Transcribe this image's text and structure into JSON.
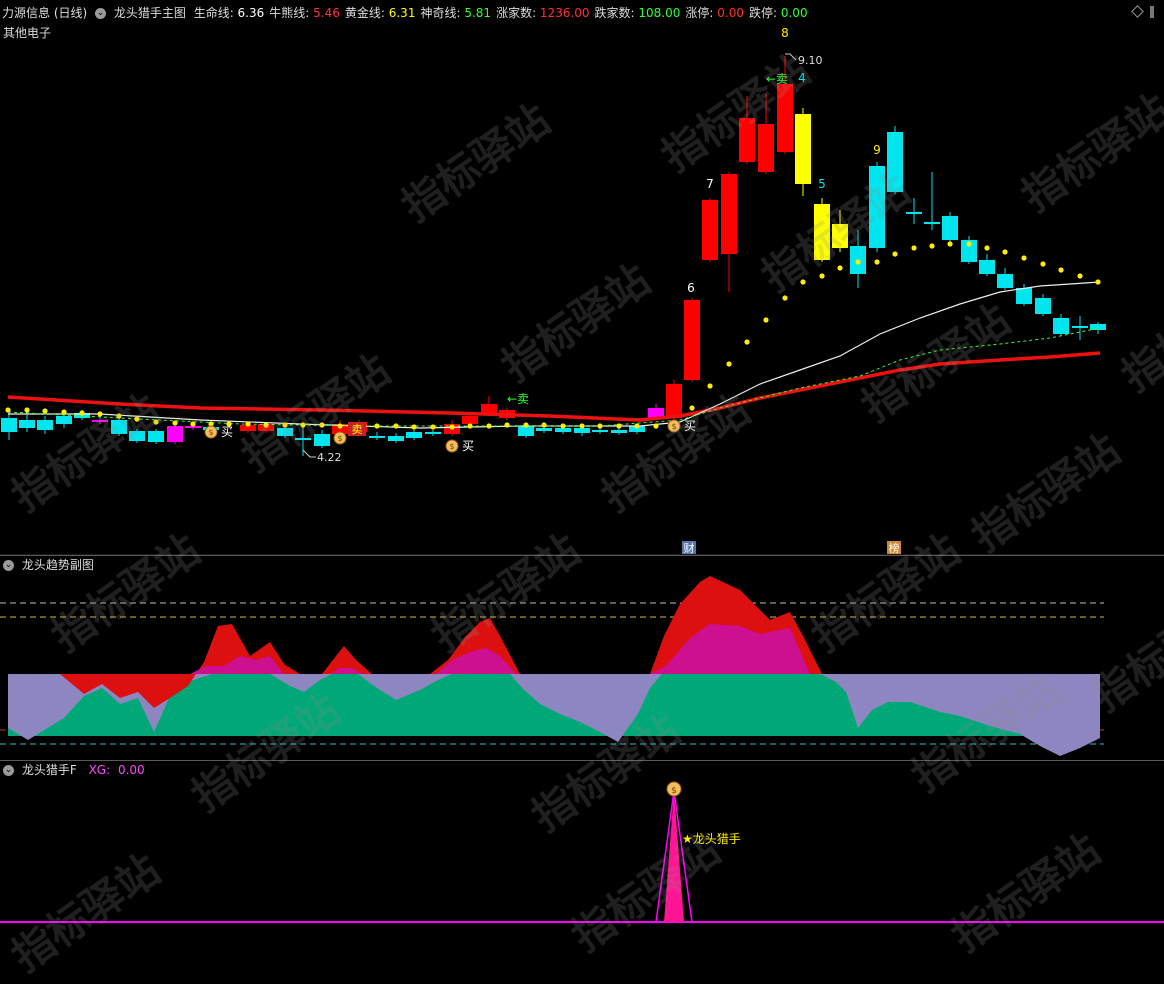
{
  "header": {
    "app_title": "力源信息 (日线)",
    "indicator_name": "龙头猎手主图",
    "sub_title": "其他电子",
    "values": [
      {
        "label": "生命线:",
        "value": "6.36",
        "color": "#ffffff"
      },
      {
        "label": "牛熊线:",
        "value": "5.46",
        "color": "#ff3030"
      },
      {
        "label": "黄金线:",
        "value": "6.31",
        "color": "#ffff00"
      },
      {
        "label": "神奇线:",
        "value": "5.81",
        "color": "#30ff30"
      },
      {
        "label": "涨家数:",
        "value": "1236.00",
        "color": "#ff3030"
      },
      {
        "label": "跌家数:",
        "value": "108.00",
        "color": "#30ff30"
      },
      {
        "label": "涨停:",
        "value": "0.00",
        "color": "#ff3030"
      },
      {
        "label": "跌停:",
        "value": "0.00",
        "color": "#30ff30"
      }
    ]
  },
  "main_chart": {
    "annotations": {
      "high_price": "9.10",
      "low_price": "4.22",
      "sell_label_1": "←卖",
      "sell_label_2": "←卖",
      "buy_label_1": "买",
      "buy_label_2": "买",
      "buy_label_3": "买",
      "wave_numbers": [
        "6",
        "7",
        "8",
        "4",
        "5",
        "9"
      ],
      "cai_badge": "财",
      "bang_badge": "榜"
    },
    "colors": {
      "up": "#ff0000",
      "down": "#00e5ee",
      "highlight": "#ffff00",
      "special": "#ff00ff"
    }
  },
  "sub_chart": {
    "title": "龙头趋势副图"
  },
  "bottom_chart": {
    "title": "龙头猎手F",
    "xg_label": "XG:",
    "xg_value": "0.00",
    "signal_label": "★龙头猎手"
  },
  "watermark": "指标驿站"
}
